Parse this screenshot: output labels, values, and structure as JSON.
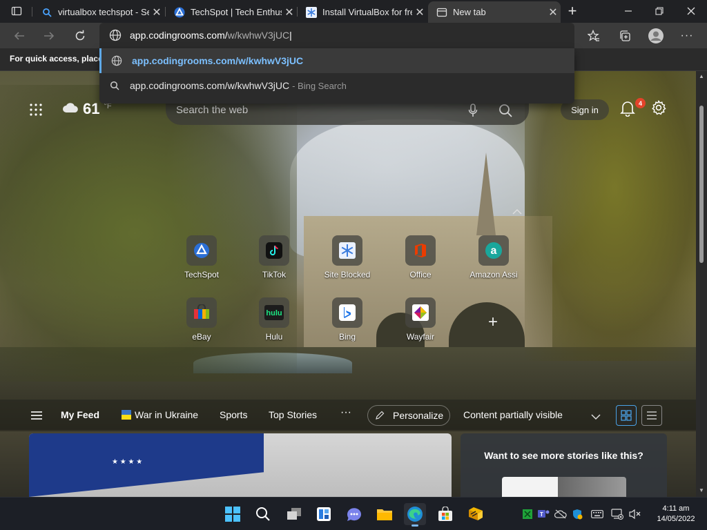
{
  "tabs": [
    {
      "title": "virtualbox techspot - Se",
      "favicon": "search-icon"
    },
    {
      "title": "TechSpot | Tech Enthusi",
      "favicon": "techspot-icon"
    },
    {
      "title": "Install VirtualBox for fre",
      "favicon": "snowflake-icon"
    },
    {
      "title": "New tab",
      "favicon": "newtab-icon",
      "active": true
    }
  ],
  "address_bar": {
    "typed": "app.codingrooms.com/",
    "autocomplete": "w/kwhwV3jUC"
  },
  "suggestions": [
    {
      "text": "app.codingrooms.com/w/kwhwV3jUC",
      "sub": ""
    },
    {
      "text": "app.codingrooms.com/w/kwhwV3jUC",
      "sub": "- Bing Search"
    }
  ],
  "favorites_bar": {
    "message": "For quick access, place y"
  },
  "page": {
    "weather": {
      "temp": "61",
      "unit": "°F"
    },
    "search_placeholder": "Search the web",
    "sign_in": "Sign in",
    "notifications": "4"
  },
  "quick_links": [
    {
      "label": "TechSpot",
      "icon": "techspot-icon"
    },
    {
      "label": "TikTok",
      "icon": "tiktok-icon"
    },
    {
      "label": "Site Blocked",
      "icon": "snowflake-icon"
    },
    {
      "label": "Office",
      "icon": "office-icon"
    },
    {
      "label": "Amazon Assi",
      "icon": "amazon-icon"
    },
    {
      "label": "eBay",
      "icon": "ebay-icon"
    },
    {
      "label": "Hulu",
      "icon": "hulu-icon"
    },
    {
      "label": "Bing",
      "icon": "bing-icon"
    },
    {
      "label": "Wayfair",
      "icon": "wayfair-icon"
    }
  ],
  "feed": {
    "my_feed": "My Feed",
    "items": [
      "War in Ukraine",
      "Sports",
      "Top Stories"
    ],
    "more": "···",
    "personalize": "Personalize",
    "content_visibility": "Content partially visible"
  },
  "cards": {
    "prompt": "Want to see more stories like this?"
  },
  "clock": {
    "time": "4:11 am",
    "date": "14/05/2022"
  },
  "colors": {
    "accent": "#5ea9e8",
    "badge": "#e3432a",
    "tab_active": "#3b3b3b"
  }
}
